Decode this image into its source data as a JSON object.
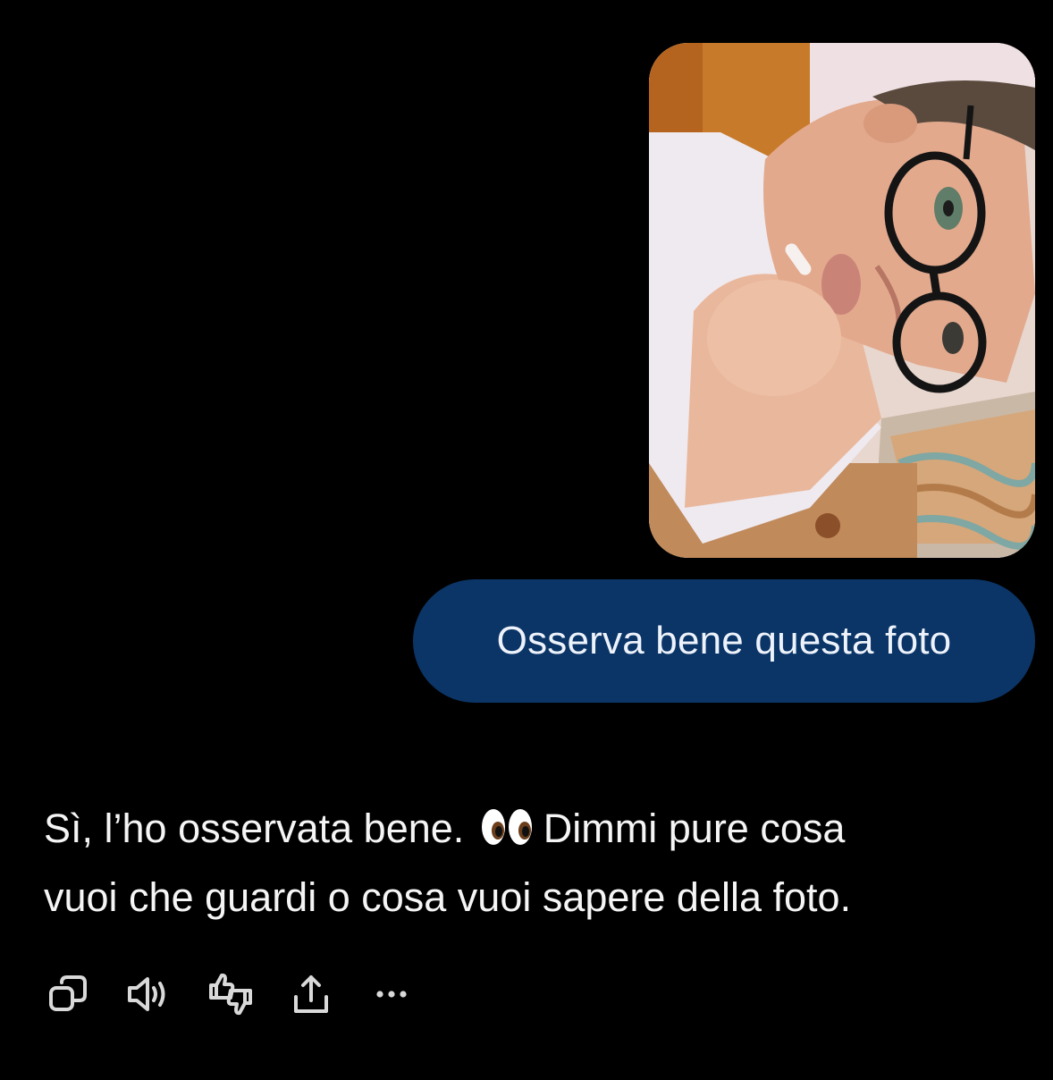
{
  "conversation": {
    "user_image": {
      "icon": "photo-attachment",
      "description_hidden": true
    },
    "user_message": "Osserva bene questa foto",
    "assistant_message": {
      "line1_before_emoji": "Sì, l’ho osservata bene.",
      "emoji": "👀",
      "line1_after_emoji": "Dimmi pure cosa",
      "line2": "vuoi che guardi o cosa vuoi sapere della foto."
    }
  },
  "actions": [
    {
      "icon": "copy-icon"
    },
    {
      "icon": "speaker-icon"
    },
    {
      "icon": "thumbs-feedback-icon"
    },
    {
      "icon": "share-icon"
    },
    {
      "icon": "more-icon"
    }
  ],
  "colors": {
    "background": "#000000",
    "user_bubble": "#0b3567",
    "user_text": "#eef3fb",
    "assistant_text": "#f5f5f5",
    "icon_color": "#d9d9d9"
  }
}
